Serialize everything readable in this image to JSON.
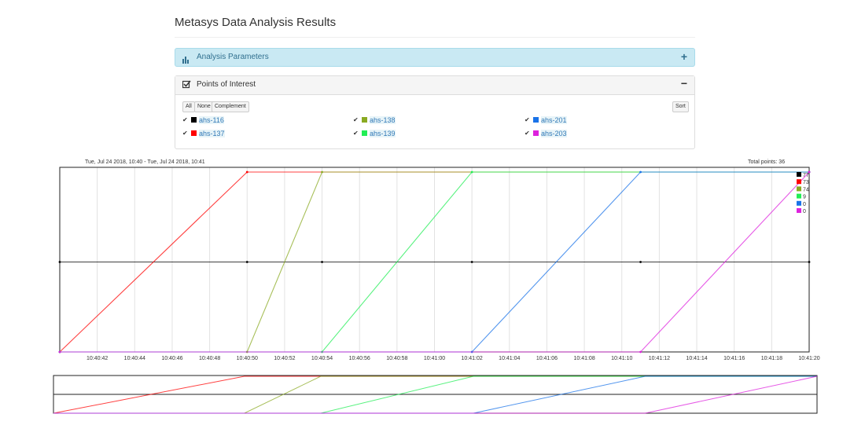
{
  "page": {
    "title": "Metasys Data Analysis Results"
  },
  "panels": {
    "params": {
      "title": "Analysis Parameters",
      "icon": "bar-chart-icon",
      "toggle": "+"
    },
    "poi": {
      "title": "Points of Interest",
      "icon": "checkbox-icon",
      "toggle": "−"
    }
  },
  "poi": {
    "buttons": {
      "all": "All",
      "none": "None",
      "complement": "Complement",
      "sort": "Sort"
    },
    "items": [
      {
        "label": "ahs-116",
        "color": "#000000",
        "checked": true
      },
      {
        "label": "ahs-137",
        "color": "#ff0000",
        "checked": true
      },
      {
        "label": "ahs-138",
        "color": "#8aaa22",
        "checked": true
      },
      {
        "label": "ahs-139",
        "color": "#22ee55",
        "checked": true
      },
      {
        "label": "ahs-201",
        "color": "#1a73e8",
        "checked": true
      },
      {
        "label": "ahs-203",
        "color": "#dd22dd",
        "checked": true
      }
    ]
  },
  "chart_meta": {
    "range_text": "Tue, Jul 24 2018, 10:40 - Tue, Jul 24 2018, 10:41",
    "total_text": "Total points: 36"
  },
  "chart_data": {
    "type": "line",
    "grid": true,
    "x_ticks": [
      "10:40:42",
      "10:40:44",
      "10:40:46",
      "10:40:48",
      "10:40:50",
      "10:40:52",
      "10:40:54",
      "10:40:56",
      "10:40:58",
      "10:41:00",
      "10:41:02",
      "10:41:04",
      "10:41:06",
      "10:41:08",
      "10:41:10",
      "10:41:12",
      "10:41:14",
      "10:41:16",
      "10:41:18",
      "10:41:20"
    ],
    "xlim": [
      "10:40:40",
      "10:41:20"
    ],
    "ylim": [
      0,
      1
    ],
    "legend_position": "top-right",
    "series": [
      {
        "color": "#000000",
        "legend_value": "77",
        "points": [
          [
            "10:40:40",
            0.5
          ],
          [
            "10:40:50",
            0.5
          ],
          [
            "10:40:54",
            0.5
          ],
          [
            "10:41:02",
            0.5
          ],
          [
            "10:41:11",
            0.5
          ],
          [
            "10:41:20",
            0.5
          ]
        ]
      },
      {
        "color": "#ff0000",
        "legend_value": "73",
        "points": [
          [
            "10:40:40",
            0
          ],
          [
            "10:40:50",
            1
          ],
          [
            "10:41:20",
            1
          ]
        ]
      },
      {
        "color": "#8aaa22",
        "legend_value": "74",
        "points": [
          [
            "10:40:40",
            0
          ],
          [
            "10:40:50",
            0
          ],
          [
            "10:40:54",
            1
          ],
          [
            "10:41:20",
            1
          ]
        ]
      },
      {
        "color": "#22ee55",
        "legend_value": "9",
        "points": [
          [
            "10:40:40",
            0
          ],
          [
            "10:40:54",
            0
          ],
          [
            "10:41:02",
            1
          ],
          [
            "10:41:20",
            1
          ]
        ]
      },
      {
        "color": "#1a73e8",
        "legend_value": "0",
        "points": [
          [
            "10:40:40",
            0
          ],
          [
            "10:41:02",
            0
          ],
          [
            "10:41:11",
            1
          ],
          [
            "10:41:20",
            1
          ]
        ]
      },
      {
        "color": "#dd22dd",
        "legend_value": "0",
        "points": [
          [
            "10:40:40",
            0
          ],
          [
            "10:41:11",
            0
          ],
          [
            "10:41:20",
            1
          ]
        ]
      }
    ]
  }
}
